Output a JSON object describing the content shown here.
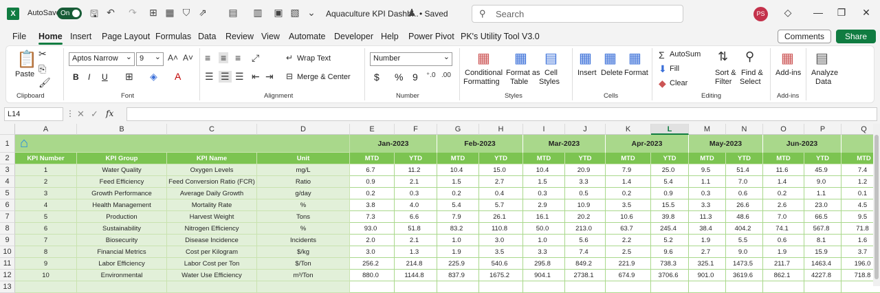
{
  "titlebar": {
    "autosave_label": "AutoSave",
    "toggle_label": "On",
    "doc_title": "Aquaculture KPI Dashb...",
    "saved_label": "• Saved",
    "search_placeholder": "Search",
    "avatar_initials": "PS"
  },
  "menus": [
    "File",
    "Home",
    "Insert",
    "Page Layout",
    "Formulas",
    "Data",
    "Review",
    "View",
    "Automate",
    "Developer",
    "Help",
    "Power Pivot",
    "PK's Utility Tool V3.0"
  ],
  "menu_buttons": {
    "comments": "Comments",
    "share": "Share"
  },
  "ribbon": {
    "paste": "Paste",
    "font_name": "Aptos Narrow",
    "font_size": "9",
    "bold": "B",
    "italic": "I",
    "underline": "U",
    "wrap_text": "Wrap Text",
    "merge_center": "Merge & Center",
    "number_format": "Number",
    "currency": "$",
    "percent": "%",
    "comma": "9",
    "conditional": "Conditional",
    "formatting": "Formatting",
    "format_as": "Format as",
    "table": "Table",
    "cell": "Cell",
    "styles_btn": "Styles",
    "insert": "Insert",
    "delete": "Delete",
    "format": "Format",
    "autosum": "AutoSum",
    "fill": "Fill",
    "clear": "Clear",
    "sort": "Sort &",
    "filter": "Filter",
    "find": "Find &",
    "select": "Select",
    "addins": "Add-ins",
    "analyze": "Analyze",
    "data": "Data",
    "groups": {
      "clipboard": "Clipboard",
      "font": "Font",
      "alignment": "Alignment",
      "number": "Number",
      "styles": "Styles",
      "cells": "Cells",
      "editing": "Editing",
      "addins": "Add-ins"
    }
  },
  "formula": {
    "namebox": "L14",
    "fx": "fx"
  },
  "columns": [
    "A",
    "B",
    "C",
    "D",
    "E",
    "F",
    "G",
    "H",
    "I",
    "J",
    "K",
    "L",
    "M",
    "N",
    "O",
    "P",
    "Q"
  ],
  "rows": [
    "1",
    "2",
    "3",
    "4",
    "5",
    "6",
    "7",
    "8",
    "9",
    "10",
    "11",
    "12",
    "13"
  ],
  "months": [
    "Jan-2023",
    "Feb-2023",
    "Mar-2023",
    "Apr-2023",
    "May-2023",
    "Jun-2023"
  ],
  "headers": [
    "KPI Number",
    "KPI Group",
    "KPI Name",
    "Unit",
    "MTD",
    "YTD",
    "MTD",
    "YTD",
    "MTD",
    "YTD",
    "MTD",
    "YTD",
    "MTD",
    "YTD",
    "MTD",
    "YTD",
    "MTD"
  ],
  "table": [
    [
      "1",
      "Water Quality",
      "Oxygen Levels",
      "mg/L",
      "6.7",
      "11.2",
      "10.4",
      "15.0",
      "10.4",
      "20.9",
      "7.9",
      "25.0",
      "9.5",
      "51.4",
      "11.6",
      "45.9",
      "7.4"
    ],
    [
      "2",
      "Feed Efficiency",
      "Feed Conversion Ratio (FCR)",
      "Ratio",
      "0.9",
      "2.1",
      "1.5",
      "2.7",
      "1.5",
      "3.3",
      "1.4",
      "5.4",
      "1.1",
      "7.0",
      "1.4",
      "9.0",
      "1.2"
    ],
    [
      "3",
      "Growth Performance",
      "Average Daily Growth",
      "g/day",
      "0.2",
      "0.3",
      "0.2",
      "0.4",
      "0.3",
      "0.5",
      "0.2",
      "0.9",
      "0.3",
      "0.6",
      "0.2",
      "1.1",
      "0.1"
    ],
    [
      "4",
      "Health Management",
      "Mortality Rate",
      "%",
      "3.8",
      "4.0",
      "5.4",
      "5.7",
      "2.9",
      "10.9",
      "3.5",
      "15.5",
      "3.3",
      "26.6",
      "2.6",
      "23.0",
      "4.5"
    ],
    [
      "5",
      "Production",
      "Harvest Weight",
      "Tons",
      "7.3",
      "6.6",
      "7.9",
      "26.1",
      "16.1",
      "20.2",
      "10.6",
      "39.8",
      "11.3",
      "48.6",
      "7.0",
      "66.5",
      "9.5"
    ],
    [
      "6",
      "Sustainability",
      "Nitrogen Efficiency",
      "%",
      "93.0",
      "51.8",
      "83.2",
      "110.8",
      "50.0",
      "213.0",
      "63.7",
      "245.4",
      "38.4",
      "404.2",
      "74.1",
      "567.8",
      "71.8"
    ],
    [
      "7",
      "Biosecurity",
      "Disease Incidence",
      "Incidents",
      "2.0",
      "2.1",
      "1.0",
      "3.0",
      "1.0",
      "5.6",
      "2.2",
      "5.2",
      "1.9",
      "5.5",
      "0.6",
      "8.1",
      "1.6"
    ],
    [
      "8",
      "Financial Metrics",
      "Cost per Kilogram",
      "$/kg",
      "3.0",
      "1.3",
      "1.9",
      "3.5",
      "3.3",
      "7.4",
      "2.5",
      "9.6",
      "2.7",
      "9.0",
      "1.9",
      "15.9",
      "3.7"
    ],
    [
      "9",
      "Labor Efficiency",
      "Labor Cost per Ton",
      "$/Ton",
      "256.2",
      "214.8",
      "225.9",
      "540.6",
      "295.8",
      "849.2",
      "221.9",
      "738.3",
      "325.1",
      "1473.5",
      "211.7",
      "1463.4",
      "196.0"
    ],
    [
      "10",
      "Environmental",
      "Water Use Efficiency",
      "m³/Ton",
      "880.0",
      "1144.8",
      "837.9",
      "1675.2",
      "904.1",
      "2738.1",
      "674.9",
      "3706.6",
      "901.0",
      "3619.6",
      "862.1",
      "4227.8",
      "718.8"
    ]
  ]
}
